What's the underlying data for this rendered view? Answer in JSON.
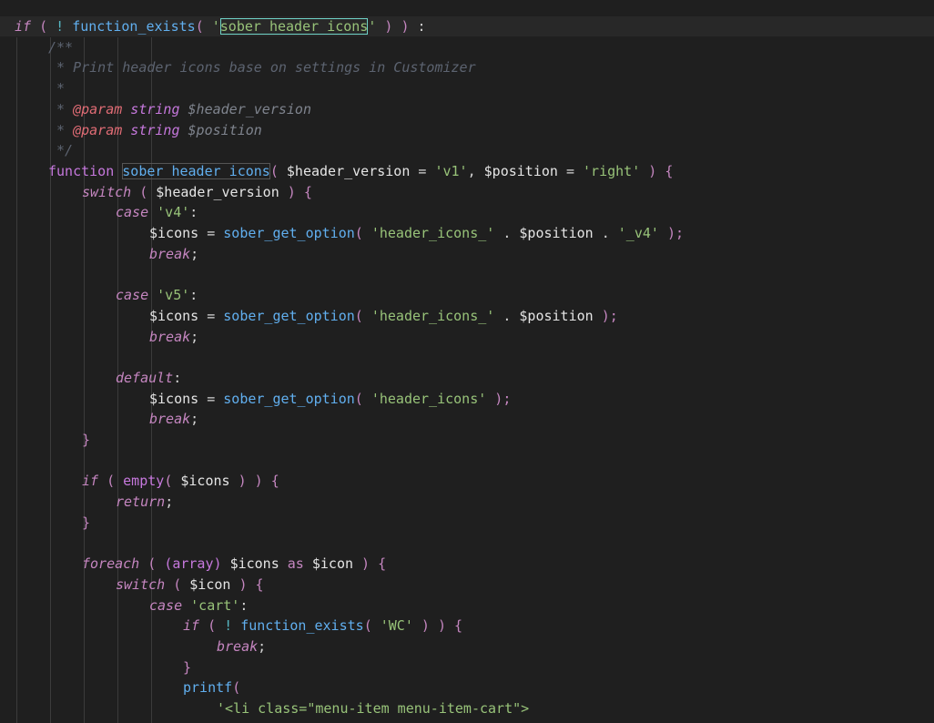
{
  "editor": {
    "language": "php",
    "colors": {
      "background": "#1f1f1f",
      "keyword": "#c586c0",
      "function": "#61afef",
      "string": "#98c379",
      "comment": "#5c6370",
      "match_highlight": "#6fd3c7"
    },
    "lines": [
      {
        "indent": 0,
        "tokens": [
          {
            "t": "if",
            "c": "k-if"
          },
          {
            "t": " ",
            "c": "pun"
          },
          {
            "t": "(",
            "c": "par"
          },
          {
            "t": " ! ",
            "c": "op"
          },
          {
            "t": "function_exists",
            "c": "fn"
          },
          {
            "t": "( ",
            "c": "par"
          },
          {
            "t": "'",
            "c": "str"
          },
          {
            "t": "sober_header_icons",
            "c": "str hl-box"
          },
          {
            "t": "'",
            "c": "str"
          },
          {
            "t": " ) ",
            "c": "par"
          },
          {
            "t": ")",
            "c": "par"
          },
          {
            "t": " :",
            "c": "pun"
          }
        ]
      },
      {
        "indent": 1,
        "tokens": [
          {
            "t": "/**",
            "c": "cmt"
          }
        ]
      },
      {
        "indent": 1,
        "tokens": [
          {
            "t": " * Print header icons base on settings in Customizer",
            "c": "cmt"
          }
        ]
      },
      {
        "indent": 1,
        "tokens": [
          {
            "t": " *",
            "c": "cmt"
          }
        ]
      },
      {
        "indent": 1,
        "tokens": [
          {
            "t": " * ",
            "c": "cmt"
          },
          {
            "t": "@param",
            "c": "cmt-tag"
          },
          {
            "t": " string ",
            "c": "cmt-type"
          },
          {
            "t": "$header_version",
            "c": "cmt-var"
          }
        ]
      },
      {
        "indent": 1,
        "tokens": [
          {
            "t": " * ",
            "c": "cmt"
          },
          {
            "t": "@param",
            "c": "cmt-tag"
          },
          {
            "t": " string ",
            "c": "cmt-type"
          },
          {
            "t": "$position",
            "c": "cmt-var"
          }
        ]
      },
      {
        "indent": 1,
        "tokens": [
          {
            "t": " */",
            "c": "cmt"
          }
        ]
      },
      {
        "indent": 1,
        "tokens": [
          {
            "t": "function",
            "c": "fnk"
          },
          {
            "t": " ",
            "c": "pun"
          },
          {
            "t": "sober_header_icons",
            "c": "fn fn-box"
          },
          {
            "t": "( ",
            "c": "par"
          },
          {
            "t": "$header_version",
            "c": "var"
          },
          {
            "t": " = ",
            "c": "pun"
          },
          {
            "t": "'v1'",
            "c": "str"
          },
          {
            "t": ", ",
            "c": "pun"
          },
          {
            "t": "$position",
            "c": "var"
          },
          {
            "t": " = ",
            "c": "pun"
          },
          {
            "t": "'right'",
            "c": "str"
          },
          {
            "t": " ) ",
            "c": "par"
          },
          {
            "t": "{",
            "c": "par"
          }
        ]
      },
      {
        "indent": 2,
        "tokens": [
          {
            "t": "switch",
            "c": "ctl"
          },
          {
            "t": " ( ",
            "c": "par"
          },
          {
            "t": "$header_version",
            "c": "var"
          },
          {
            "t": " ) ",
            "c": "par"
          },
          {
            "t": "{",
            "c": "par"
          }
        ]
      },
      {
        "indent": 3,
        "tokens": [
          {
            "t": "case",
            "c": "ctl"
          },
          {
            "t": " ",
            "c": "pun"
          },
          {
            "t": "'v4'",
            "c": "str"
          },
          {
            "t": ":",
            "c": "pun"
          }
        ]
      },
      {
        "indent": 4,
        "tokens": [
          {
            "t": "$icons",
            "c": "var"
          },
          {
            "t": " = ",
            "c": "pun"
          },
          {
            "t": "sober_get_option",
            "c": "fn"
          },
          {
            "t": "( ",
            "c": "par"
          },
          {
            "t": "'header_icons_'",
            "c": "str"
          },
          {
            "t": " . ",
            "c": "pun"
          },
          {
            "t": "$position",
            "c": "var"
          },
          {
            "t": " . ",
            "c": "pun"
          },
          {
            "t": "'_v4'",
            "c": "str"
          },
          {
            "t": " );",
            "c": "par"
          }
        ]
      },
      {
        "indent": 4,
        "tokens": [
          {
            "t": "break",
            "c": "ctl"
          },
          {
            "t": ";",
            "c": "pun"
          }
        ]
      },
      {
        "indent": 0,
        "tokens": []
      },
      {
        "indent": 3,
        "tokens": [
          {
            "t": "case",
            "c": "ctl"
          },
          {
            "t": " ",
            "c": "pun"
          },
          {
            "t": "'v5'",
            "c": "str"
          },
          {
            "t": ":",
            "c": "pun"
          }
        ]
      },
      {
        "indent": 4,
        "tokens": [
          {
            "t": "$icons",
            "c": "var"
          },
          {
            "t": " = ",
            "c": "pun"
          },
          {
            "t": "sober_get_option",
            "c": "fn"
          },
          {
            "t": "( ",
            "c": "par"
          },
          {
            "t": "'header_icons_'",
            "c": "str"
          },
          {
            "t": " . ",
            "c": "pun"
          },
          {
            "t": "$position",
            "c": "var"
          },
          {
            "t": " );",
            "c": "par"
          }
        ]
      },
      {
        "indent": 4,
        "tokens": [
          {
            "t": "break",
            "c": "ctl"
          },
          {
            "t": ";",
            "c": "pun"
          }
        ]
      },
      {
        "indent": 0,
        "tokens": []
      },
      {
        "indent": 3,
        "tokens": [
          {
            "t": "default",
            "c": "ctl"
          },
          {
            "t": ":",
            "c": "pun"
          }
        ]
      },
      {
        "indent": 4,
        "tokens": [
          {
            "t": "$icons",
            "c": "var"
          },
          {
            "t": " = ",
            "c": "pun"
          },
          {
            "t": "sober_get_option",
            "c": "fn"
          },
          {
            "t": "( ",
            "c": "par"
          },
          {
            "t": "'header_icons'",
            "c": "str"
          },
          {
            "t": " );",
            "c": "par"
          }
        ]
      },
      {
        "indent": 4,
        "tokens": [
          {
            "t": "break",
            "c": "ctl"
          },
          {
            "t": ";",
            "c": "pun"
          }
        ]
      },
      {
        "indent": 2,
        "tokens": [
          {
            "t": "}",
            "c": "par"
          }
        ]
      },
      {
        "indent": 0,
        "tokens": []
      },
      {
        "indent": 2,
        "tokens": [
          {
            "t": "if",
            "c": "k-if"
          },
          {
            "t": " ( ",
            "c": "par"
          },
          {
            "t": "empty",
            "c": "fnk"
          },
          {
            "t": "( ",
            "c": "par"
          },
          {
            "t": "$icons",
            "c": "var"
          },
          {
            "t": " ) ) ",
            "c": "par"
          },
          {
            "t": "{",
            "c": "par"
          }
        ]
      },
      {
        "indent": 3,
        "tokens": [
          {
            "t": "return",
            "c": "ctl"
          },
          {
            "t": ";",
            "c": "pun"
          }
        ]
      },
      {
        "indent": 2,
        "tokens": [
          {
            "t": "}",
            "c": "par"
          }
        ]
      },
      {
        "indent": 0,
        "tokens": []
      },
      {
        "indent": 2,
        "tokens": [
          {
            "t": "foreach",
            "c": "ctl"
          },
          {
            "t": " ( ",
            "c": "par"
          },
          {
            "t": "(array)",
            "c": "vsg"
          },
          {
            "t": " ",
            "c": "pun"
          },
          {
            "t": "$icons",
            "c": "var"
          },
          {
            "t": " as ",
            "c": "kw"
          },
          {
            "t": "$icon",
            "c": "var"
          },
          {
            "t": " ) ",
            "c": "par"
          },
          {
            "t": "{",
            "c": "par"
          }
        ]
      },
      {
        "indent": 3,
        "tokens": [
          {
            "t": "switch",
            "c": "ctl"
          },
          {
            "t": " ( ",
            "c": "par"
          },
          {
            "t": "$icon",
            "c": "var"
          },
          {
            "t": " ) ",
            "c": "par"
          },
          {
            "t": "{",
            "c": "par"
          }
        ]
      },
      {
        "indent": 4,
        "tokens": [
          {
            "t": "case",
            "c": "ctl"
          },
          {
            "t": " ",
            "c": "pun"
          },
          {
            "t": "'cart'",
            "c": "str"
          },
          {
            "t": ":",
            "c": "pun"
          }
        ]
      },
      {
        "indent": 5,
        "tokens": [
          {
            "t": "if",
            "c": "k-if"
          },
          {
            "t": " ( ",
            "c": "par"
          },
          {
            "t": "! ",
            "c": "op"
          },
          {
            "t": "function_exists",
            "c": "fn"
          },
          {
            "t": "( ",
            "c": "par"
          },
          {
            "t": "'WC'",
            "c": "str"
          },
          {
            "t": " ) ) ",
            "c": "par"
          },
          {
            "t": "{",
            "c": "par"
          }
        ]
      },
      {
        "indent": 6,
        "tokens": [
          {
            "t": "break",
            "c": "ctl"
          },
          {
            "t": ";",
            "c": "pun"
          }
        ]
      },
      {
        "indent": 5,
        "tokens": [
          {
            "t": "}",
            "c": "par"
          }
        ]
      },
      {
        "indent": 5,
        "tokens": [
          {
            "t": "printf",
            "c": "fn"
          },
          {
            "t": "(",
            "c": "par"
          }
        ]
      },
      {
        "indent": 6,
        "tokens": [
          {
            "t": "'<li class=\"menu-item menu-item-cart\">",
            "c": "str"
          }
        ]
      }
    ]
  }
}
